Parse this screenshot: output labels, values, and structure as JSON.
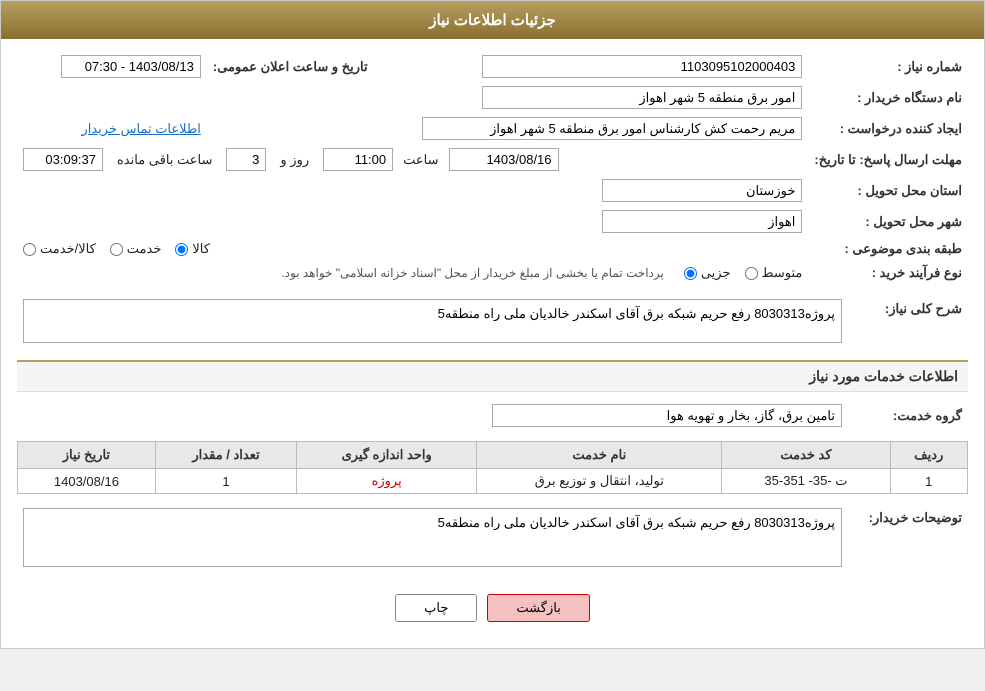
{
  "header": {
    "title": "جزئیات اطلاعات نیاز"
  },
  "fields": {
    "need_number_label": "شماره نیاز :",
    "need_number_value": "1103095102000403",
    "buyer_org_label": "نام دستگاه خریدار :",
    "buyer_org_value": "امور برق منطقه 5 شهر اهواز",
    "creator_label": "ایجاد کننده درخواست :",
    "creator_value": "مریم رحمت کش کارشناس امور برق منطقه 5 شهر اهواز",
    "creator_link": "اطلاعات تماس خریدار",
    "deadline_label": "مهلت ارسال پاسخ: تا تاریخ:",
    "deadline_date": "1403/08/16",
    "deadline_time_label": "ساعت",
    "deadline_time": "11:00",
    "deadline_days_label": "روز و",
    "deadline_days": "3",
    "deadline_remaining_label": "ساعت باقی مانده",
    "deadline_remaining": "03:09:37",
    "announce_date_label": "تاریخ و ساعت اعلان عمومی:",
    "announce_date_value": "1403/08/13 - 07:30",
    "province_label": "استان محل تحویل :",
    "province_value": "خوزستان",
    "city_label": "شهر محل تحویل :",
    "city_value": "اهواز",
    "category_label": "طبقه بندی موضوعی :",
    "category_kala": "کالا",
    "category_khedmat": "خدمت",
    "category_kala_khedmat": "کالا/خدمت",
    "process_label": "نوع فرآیند خرید :",
    "process_jozvi": "جزیی",
    "process_motavaset": "متوسط",
    "process_note": "پرداخت تمام یا بخشی از مبلغ خریدار از محل \"اسناد خزانه اسلامی\" خواهد بود.",
    "need_desc_label": "شرح کلی نیاز:",
    "need_desc_value": "پروژه8030313 رفع حریم شبکه برق آقای اسکندر خالدیان ملی راه منطقه5",
    "services_section_label": "اطلاعات خدمات مورد نیاز",
    "service_group_label": "گروه خدمت:",
    "service_group_value": "تامین برق، گاز، بخار و تهویه هوا"
  },
  "services_table": {
    "columns": [
      "ردیف",
      "کد خدمت",
      "نام خدمت",
      "واحد اندازه گیری",
      "تعداد / مقدار",
      "تاریخ نیاز"
    ],
    "rows": [
      {
        "row": "1",
        "code": "ت -35- 351-35",
        "name": "تولید، انتقال و توزیع برق",
        "unit": "پروژه",
        "count": "1",
        "date": "1403/08/16"
      }
    ]
  },
  "buyer_desc_label": "توضیحات خریدار:",
  "buyer_desc_value": "پروژه8030313 رفع حریم شبکه برق آقای اسکندر خالدیان ملی راه منطقه5",
  "buttons": {
    "print": "چاپ",
    "back": "بازگشت"
  }
}
